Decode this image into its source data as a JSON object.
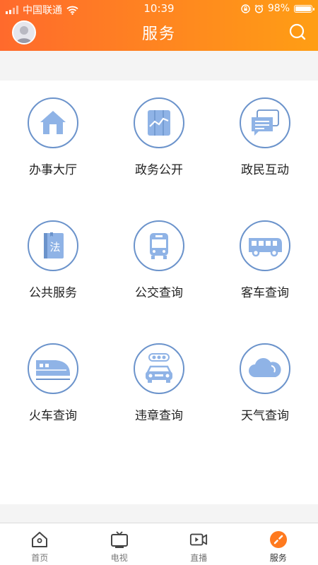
{
  "status_bar": {
    "carrier": "中国联通",
    "time": "10:39",
    "battery": "98%",
    "battery_level": 0.98
  },
  "header": {
    "title": "服务",
    "accent_gradient": [
      "#ff6a2c",
      "#ff9e14"
    ]
  },
  "services": [
    {
      "label": "办事大厅",
      "icon": "house-icon"
    },
    {
      "label": "政务公开",
      "icon": "chart-board-icon"
    },
    {
      "label": "政民互动",
      "icon": "chat-bubbles-icon"
    },
    {
      "label": "公共服务",
      "icon": "law-book-icon"
    },
    {
      "label": "公交查询",
      "icon": "bus-front-icon"
    },
    {
      "label": "客车查询",
      "icon": "coach-bus-icon"
    },
    {
      "label": "火车查询",
      "icon": "train-icon"
    },
    {
      "label": "违章查询",
      "icon": "traffic-car-icon"
    },
    {
      "label": "天气查询",
      "icon": "cloud-icon"
    }
  ],
  "tabbar": {
    "items": [
      {
        "label": "首页",
        "icon": "home-icon",
        "active": false
      },
      {
        "label": "电视",
        "icon": "tv-icon",
        "active": false
      },
      {
        "label": "直播",
        "icon": "video-icon",
        "active": false
      },
      {
        "label": "服务",
        "icon": "compass-icon",
        "active": true
      }
    ]
  },
  "colors": {
    "icon_blue": "#6b93cb",
    "icon_fill": "#8fb3e6",
    "active_tab": "#ff7a1f"
  }
}
